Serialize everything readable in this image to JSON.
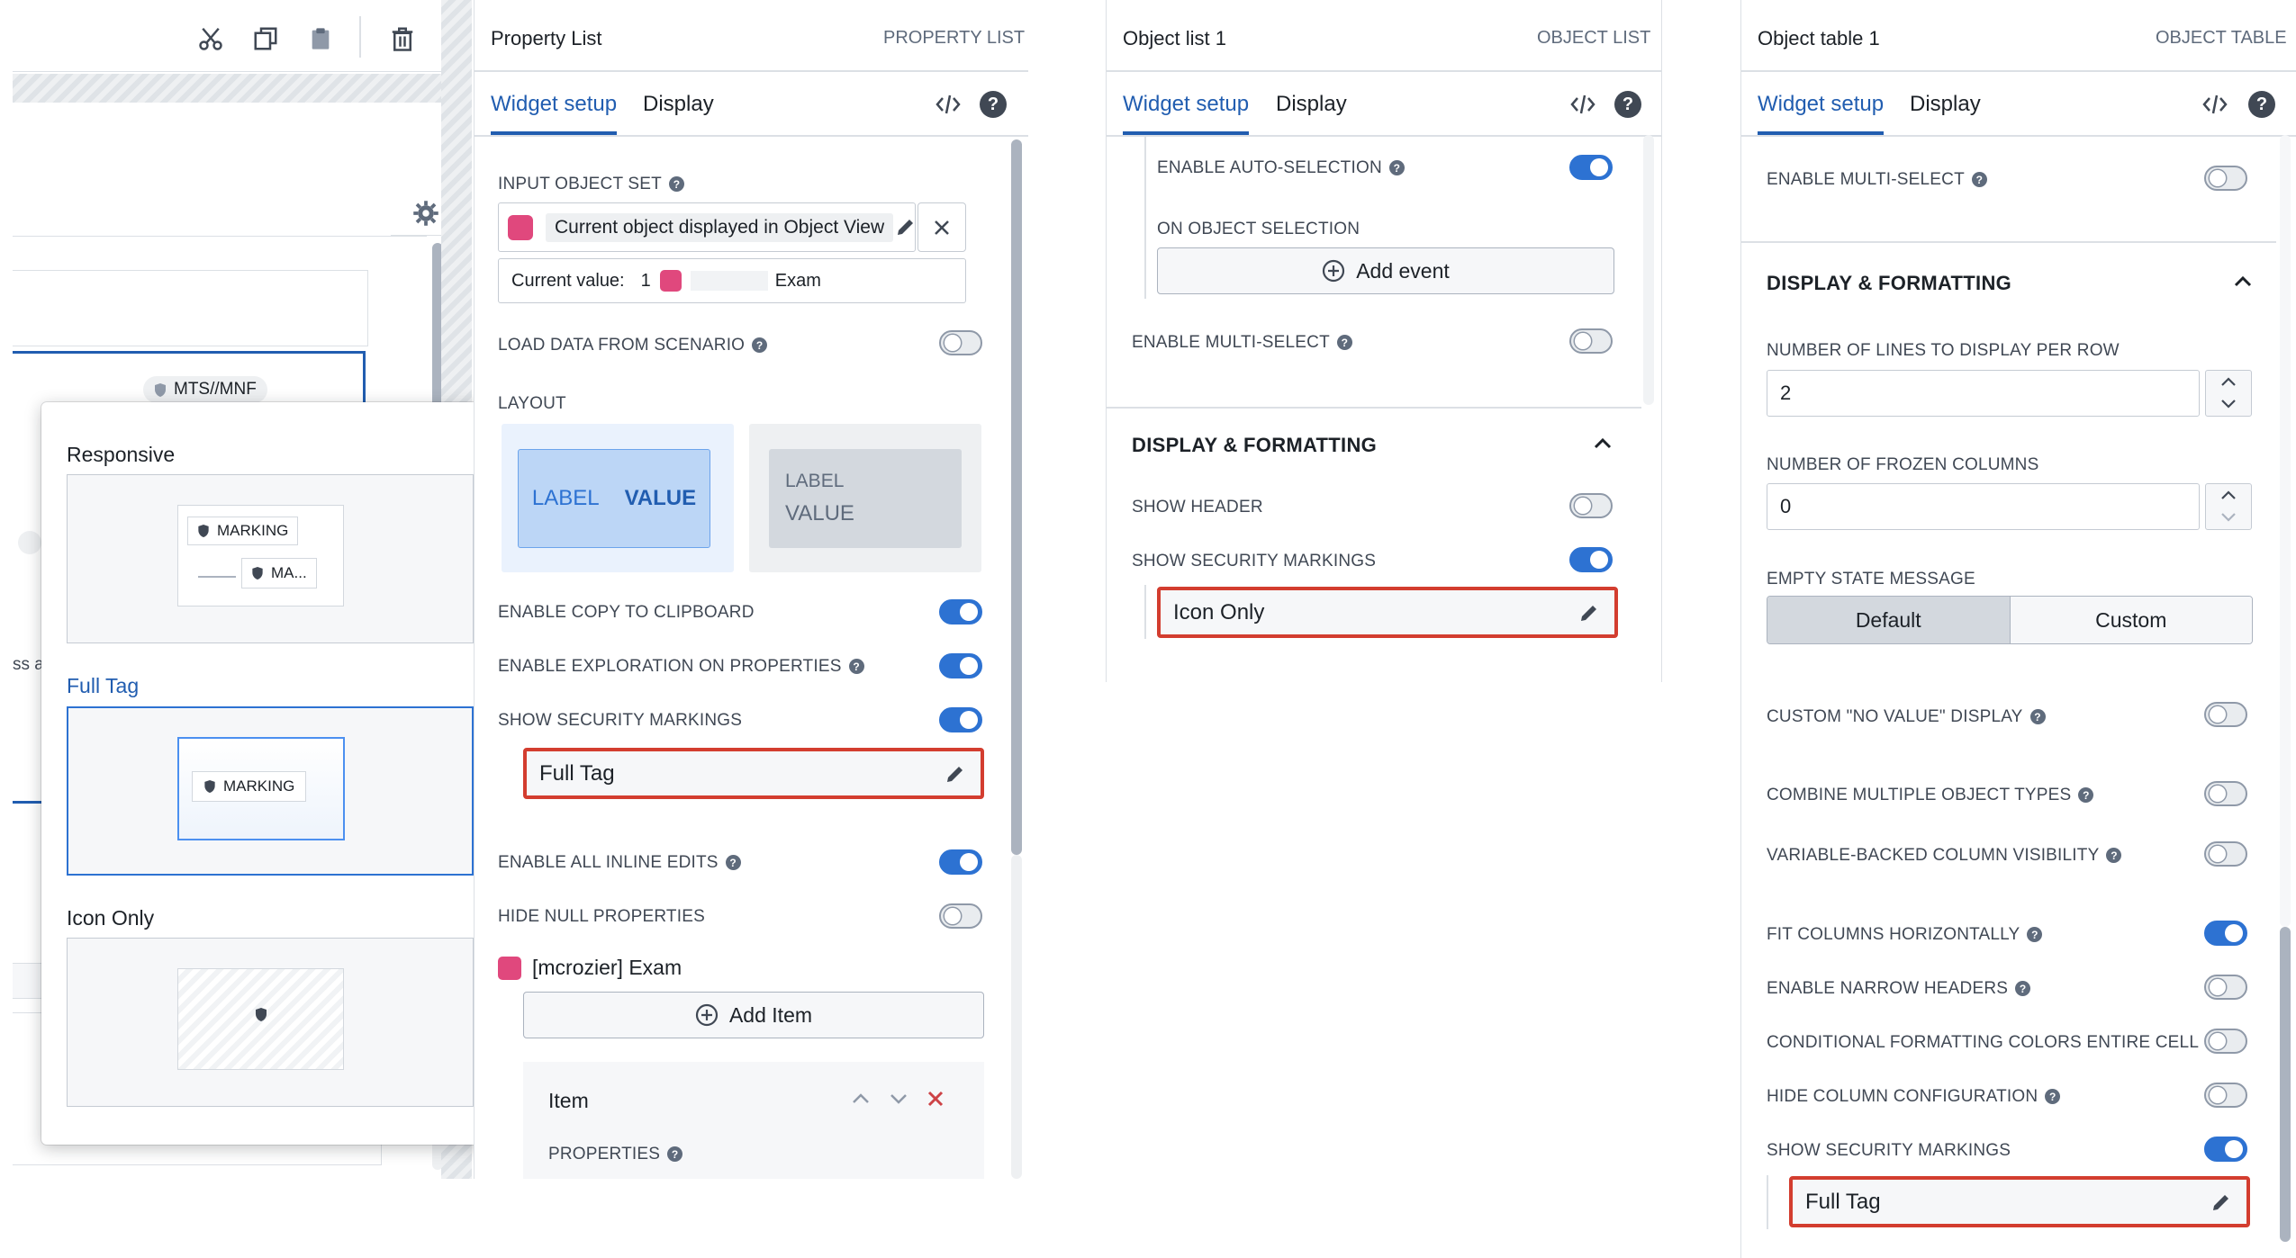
{
  "left_panel": {
    "canvas_badge": "MTS//MNF",
    "fragment_text_a": "ss a",
    "popover": {
      "options": [
        {
          "label": "Responsive",
          "chip_1": "MARKING",
          "chip_2": "MA..."
        },
        {
          "label": "Full Tag",
          "chip_1": "MARKING"
        },
        {
          "label": "Icon Only"
        }
      ]
    }
  },
  "property_list": {
    "title": "Property List",
    "type_label": "PROPERTY LIST",
    "tabs": [
      "Widget setup",
      "Display"
    ],
    "input_object_set_label": "INPUT OBJECT SET",
    "input_object_set_value": "Current object displayed in Object View",
    "current_value_label": "Current value:",
    "current_value_count": "1",
    "current_value_name": "Exam",
    "load_data_label": "LOAD DATA FROM SCENARIO",
    "layout_label": "LAYOUT",
    "layout_opt1_label": "LABEL",
    "layout_opt1_value": "VALUE",
    "layout_opt2_label": "LABEL",
    "layout_opt2_value": "VALUE",
    "copy_label": "ENABLE COPY TO CLIPBOARD",
    "exploration_label": "ENABLE EXPLORATION ON PROPERTIES",
    "security_label": "SHOW SECURITY MARKINGS",
    "security_value": "Full Tag",
    "inline_edits_label": "ENABLE ALL INLINE EDITS",
    "hide_null_label": "HIDE NULL PROPERTIES",
    "object_type": "[mcrozier] Exam",
    "add_item": "Add Item",
    "item_title": "Item",
    "properties_label": "PROPERTIES"
  },
  "object_list": {
    "title": "Object list 1",
    "type_label": "OBJECT LIST",
    "tabs": [
      "Widget setup",
      "Display"
    ],
    "auto_selection_label": "ENABLE AUTO-SELECTION",
    "on_selection_label": "ON OBJECT SELECTION",
    "add_event": "Add event",
    "multi_select_label": "ENABLE MULTI-SELECT",
    "section_title": "DISPLAY & FORMATTING",
    "show_header_label": "SHOW HEADER",
    "security_label": "SHOW SECURITY MARKINGS",
    "security_value": "Icon Only"
  },
  "object_table": {
    "title": "Object table 1",
    "type_label": "OBJECT TABLE",
    "tabs": [
      "Widget setup",
      "Display"
    ],
    "multi_select_label": "ENABLE MULTI-SELECT",
    "section_title": "DISPLAY & FORMATTING",
    "lines_label": "NUMBER OF LINES TO DISPLAY PER ROW",
    "lines_value": "2",
    "frozen_label": "NUMBER OF FROZEN COLUMNS",
    "frozen_value": "0",
    "empty_state_label": "EMPTY STATE MESSAGE",
    "empty_default": "Default",
    "empty_custom": "Custom",
    "custom_no_value_label": "CUSTOM \"NO VALUE\" DISPLAY",
    "combine_label": "COMBINE MULTIPLE OBJECT TYPES",
    "variable_label": "VARIABLE-BACKED COLUMN VISIBILITY",
    "fit_label": "FIT COLUMNS HORIZONTALLY",
    "narrow_label": "ENABLE NARROW HEADERS",
    "conditional_label": "CONDITIONAL FORMATTING COLORS ENTIRE CELL",
    "hide_config_label": "HIDE COLUMN CONFIGURATION",
    "security_label": "SHOW SECURITY MARKINGS",
    "security_value": "Full Tag"
  },
  "colors": {
    "accent": "#2d72d2",
    "highlight_red": "#d33d2f",
    "object_pink": "#e0487d"
  }
}
